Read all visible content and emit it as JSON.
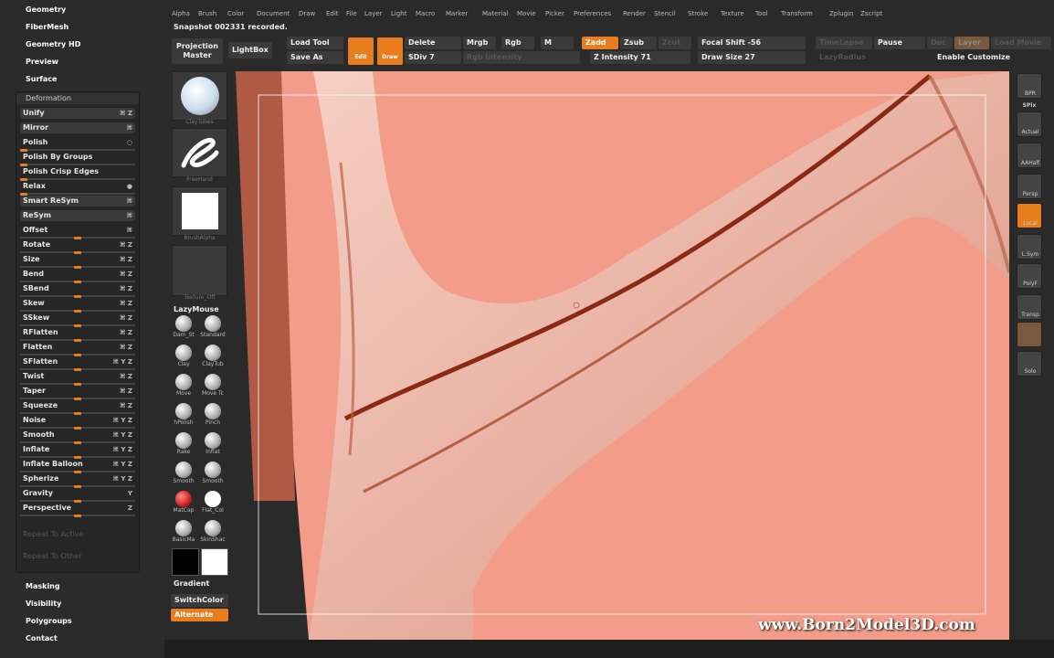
{
  "left_menu": {
    "geometry": "Geometry",
    "fibermesh": "FiberMesh",
    "geometry_hd": "Geometry HD",
    "preview": "Preview",
    "surface": "Surface",
    "masking": "Masking",
    "visibility": "Visibility",
    "polygroups": "Polygroups",
    "contact": "Contact"
  },
  "deformation": {
    "title": "Deformation",
    "items": [
      {
        "label": "Unify",
        "icons": "⌘ Z",
        "type": "btn"
      },
      {
        "label": "Mirror",
        "icons": "⌘",
        "type": "btn"
      },
      {
        "label": "Polish",
        "icons": "○",
        "type": "slider",
        "value": 0
      },
      {
        "label": "Polish By Groups",
        "icons": "",
        "type": "slider",
        "value": 0
      },
      {
        "label": "Polish Crisp Edges",
        "icons": "",
        "type": "slider",
        "value": 0
      },
      {
        "label": "Relax",
        "icons": "●",
        "type": "slider",
        "value": 0
      },
      {
        "label": "Smart ReSym",
        "icons": "⌘",
        "type": "btn"
      },
      {
        "label": "ReSym",
        "icons": "⌘",
        "type": "btn"
      },
      {
        "label": "Offset",
        "icons": "⌘",
        "type": "slider",
        "value": 0.5
      },
      {
        "label": "Rotate",
        "icons": "⌘ Z",
        "type": "slider",
        "value": 0.5
      },
      {
        "label": "Size",
        "icons": "⌘ Z",
        "type": "slider",
        "value": 0.5
      },
      {
        "label": "Bend",
        "icons": "⌘ Z",
        "type": "slider",
        "value": 0.5
      },
      {
        "label": "SBend",
        "icons": "⌘ Z",
        "type": "slider",
        "value": 0.5
      },
      {
        "label": "Skew",
        "icons": "⌘ Z",
        "type": "slider",
        "value": 0.5
      },
      {
        "label": "SSkew",
        "icons": "⌘ Z",
        "type": "slider",
        "value": 0.5
      },
      {
        "label": "RFlatten",
        "icons": "⌘ Z",
        "type": "slider",
        "value": 0.5
      },
      {
        "label": "Flatten",
        "icons": "⌘ Z",
        "type": "slider",
        "value": 0.5
      },
      {
        "label": "SFlatten",
        "icons": "⌘ Y Z",
        "type": "slider",
        "value": 0.5
      },
      {
        "label": "Twist",
        "icons": "⌘ Z",
        "type": "slider",
        "value": 0.5
      },
      {
        "label": "Taper",
        "icons": "⌘ Z",
        "type": "slider",
        "value": 0.5
      },
      {
        "label": "Squeeze",
        "icons": "⌘ Z",
        "type": "slider",
        "value": 0.5
      },
      {
        "label": "Noise",
        "icons": "⌘ Y Z",
        "type": "slider",
        "value": 0.5
      },
      {
        "label": "Smooth",
        "icons": "⌘ Y Z",
        "type": "slider",
        "value": 0.5
      },
      {
        "label": "Inflate",
        "icons": "⌘ Y Z",
        "type": "slider",
        "value": 0.5
      },
      {
        "label": "Inflate Balloon",
        "icons": "⌘ Y Z",
        "type": "slider",
        "value": 0.5
      },
      {
        "label": "Spherize",
        "icons": "⌘ Y Z",
        "type": "slider",
        "value": 0.5
      },
      {
        "label": "Gravity",
        "icons": "Y",
        "type": "slider",
        "value": 0.5
      },
      {
        "label": "Perspective",
        "icons": "Z",
        "type": "slider",
        "value": 0.5
      }
    ],
    "repeat_active": "Repeat To Active",
    "repeat_other": "Repeat To Other"
  },
  "menubar": [
    "Alpha",
    "Brush",
    "Color",
    "Document",
    "Draw",
    "Edit",
    "File",
    "Layer",
    "Light",
    "Macro",
    "Marker",
    "Material",
    "Movie",
    "Picker",
    "Preferences",
    "Render",
    "Stencil",
    "Stroke",
    "Texture",
    "Tool",
    "Transform",
    "Zplugin",
    "Zscript"
  ],
  "note": "Snapshot 002331 recorded.",
  "shelf": {
    "projection_master": "Projection Master",
    "lightbox": "LightBox",
    "load_tool": "Load Tool",
    "save_as": "Save As",
    "edit": "Edit",
    "draw": "Draw",
    "delete": "Delete",
    "sdiv": "SDiv 7",
    "mrgb": "Mrgb",
    "rgb": "Rgb",
    "m": "M",
    "rgb_intensity": "Rgb Intensity",
    "zadd": "Zadd",
    "zsub": "Zsub",
    "zcut": "Zcut",
    "z_intensity": "Z Intensity 71",
    "focal_shift": "Focal Shift -56",
    "draw_size": "Draw Size 27",
    "timelapse": "TimeLapse",
    "pause": "Pause",
    "doc": "Doc",
    "layer": "Layer",
    "load_movie": "Load Movie",
    "lazyradius": "LazyRadius",
    "enable_customize": "Enable Customize"
  },
  "tray": {
    "slot_captions": [
      "ClayTubes",
      "FreeHand",
      "BrushAlpha",
      "Texture_Off"
    ],
    "lazymouse": "LazyMouse",
    "brushes": [
      "Dam_St",
      "Standard",
      "Clay",
      "ClayTub",
      "Move",
      "Move Tc",
      "hPolish",
      "Pinch",
      "Rake",
      "Inflat",
      "Smooth",
      "Smooth",
      "MatCap",
      "Flat_Col",
      "BasicMa",
      "SkinShac"
    ],
    "gradient": "Gradient",
    "switchcolor": "SwitchColor",
    "alternate": "Alternate"
  },
  "rightbar": [
    "BPR",
    "SPix",
    "Actual",
    "AAHalf",
    "Persp",
    "Local",
    "L.Sym",
    "PolyF",
    "Transp",
    "",
    "Solo"
  ],
  "watermark": "www.Born2Model3D.com",
  "colors": {
    "accent": "#e87d1e",
    "viewport": "#f09a87"
  }
}
